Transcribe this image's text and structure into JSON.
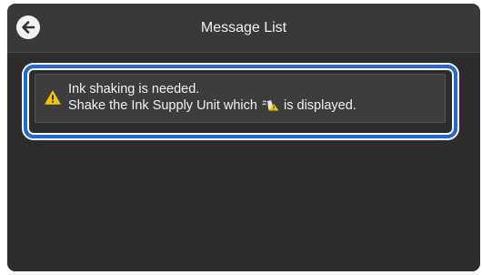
{
  "header": {
    "title": "Message List",
    "back_icon": "arrow-left-icon"
  },
  "messages": [
    {
      "icon": "warning-icon",
      "line1": "Ink shaking is needed.",
      "line2_before": "Shake the Ink Supply Unit which",
      "line2_icon": "ink-shake-icon",
      "line2_after": "is displayed.",
      "selected": true
    }
  ],
  "colors": {
    "selection": "#1f6ad6",
    "warning": "#f5c400",
    "background": "#2f2f2f"
  }
}
